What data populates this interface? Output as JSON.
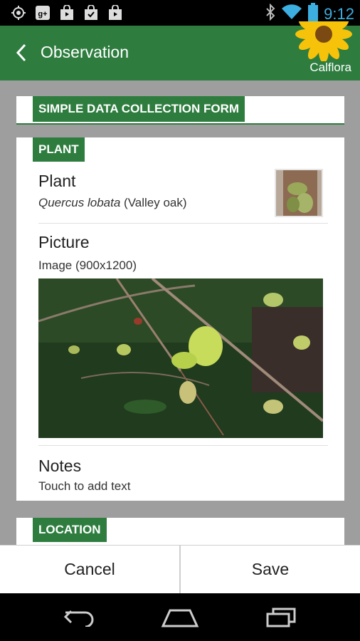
{
  "status_bar": {
    "time": "9:12",
    "left_icons": [
      "target-icon",
      "google-plus-icon",
      "shopping-bag-icon",
      "shopping-bag-check-icon",
      "play-store-icon"
    ],
    "right_icons": [
      "bluetooth-icon",
      "wifi-icon",
      "battery-icon"
    ]
  },
  "action_bar": {
    "title": "Observation",
    "brand": "Calflora",
    "colors": {
      "primary": "#2e7d3f"
    }
  },
  "form": {
    "header_tag": "SIMPLE DATA COLLECTION FORM",
    "plant_section": {
      "tag": "PLANT",
      "plant": {
        "label": "Plant",
        "scientific_name": "Quercus lobata",
        "common_name": "(Valley oak)"
      },
      "picture": {
        "label": "Picture",
        "info": "Image (900x1200)"
      },
      "notes": {
        "label": "Notes",
        "placeholder": "Touch to add text"
      }
    },
    "location_section": {
      "tag": "LOCATION"
    }
  },
  "buttons": {
    "cancel": "Cancel",
    "save": "Save"
  },
  "nav_bar": {
    "icons": [
      "back-nav-icon",
      "home-nav-icon",
      "recents-nav-icon"
    ]
  }
}
